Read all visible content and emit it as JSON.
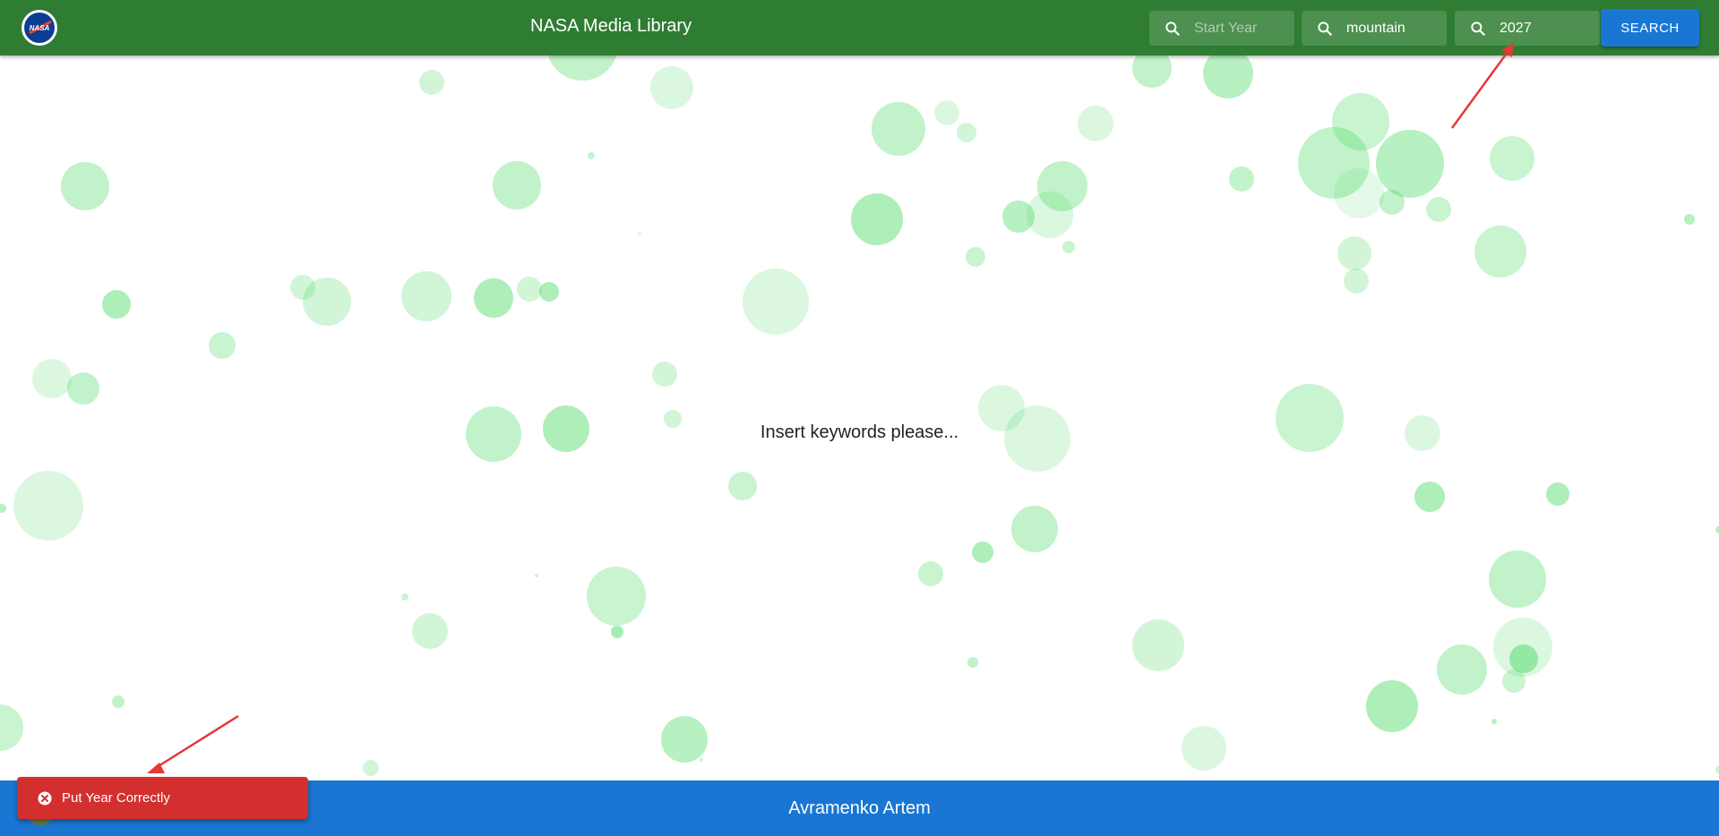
{
  "header": {
    "title": "NASA Media Library",
    "logo_alt": "NASA",
    "start_year": {
      "value": "",
      "placeholder": "Start Year"
    },
    "keywords": {
      "value": "mountain",
      "placeholder": ""
    },
    "end_year": {
      "value": "2027",
      "placeholder": ""
    },
    "search_label": "SEARCH"
  },
  "main": {
    "message": "Insert keywords please..."
  },
  "footer": {
    "author": "Avramenko Artem"
  },
  "toast": {
    "message": "Put Year Correctly",
    "status": "error"
  },
  "colors": {
    "appbar": "#2e7d32",
    "footer": "#1976d2",
    "search_button": "#1976d2",
    "toast": "#d32f2f",
    "bubble": "#4cd964",
    "annotation_arrow": "#e53935"
  }
}
